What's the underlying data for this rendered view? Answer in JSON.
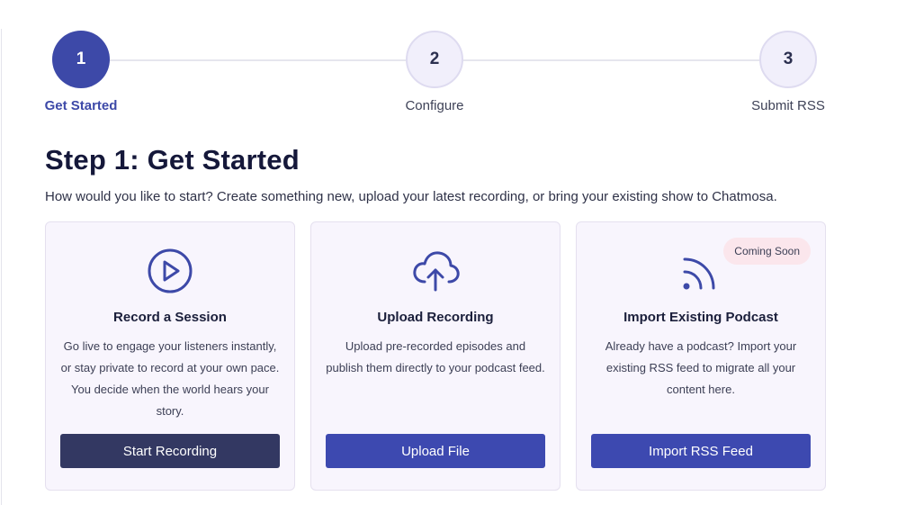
{
  "stepper": {
    "steps": [
      {
        "number": "1",
        "label": "Get Started",
        "state": "active"
      },
      {
        "number": "2",
        "label": "Configure",
        "state": "upcoming"
      },
      {
        "number": "3",
        "label": "Submit RSS",
        "state": "upcoming"
      }
    ]
  },
  "page": {
    "title": "Step 1: Get Started",
    "subtitle": "How would you like to start? Create something new, upload your latest recording, or bring your existing show to Chatmosa."
  },
  "cards": [
    {
      "icon": "play-circle-icon",
      "title": "Record a Session",
      "description": "Go live to engage your listeners instantly, or stay private to record at your own pace. You decide when the world hears your story.",
      "button": "Start Recording"
    },
    {
      "icon": "cloud-upload-icon",
      "title": "Upload Recording",
      "description": "Upload pre-recorded episodes and publish them directly to your podcast feed.",
      "button": "Upload File"
    },
    {
      "icon": "rss-icon",
      "title": "Import Existing Podcast",
      "description": "Already have a podcast? Import your existing RSS feed to migrate all your content here.",
      "button": "Import RSS Feed",
      "badge": "Coming Soon"
    }
  ],
  "colors": {
    "accent": "#3d49a8",
    "dark_button": "#333862",
    "card_background": "#f8f5fd",
    "badge_background": "#fbe6ec"
  }
}
